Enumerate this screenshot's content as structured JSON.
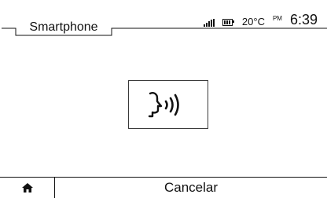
{
  "header": {
    "title": "Smartphone"
  },
  "status_bar": {
    "signal_icon": "signal-strength-icon",
    "battery_icon": "battery-icon",
    "temperature": "20°C",
    "am_pm": "PM",
    "time": "6:39"
  },
  "main": {
    "voice_button_icon": "voice-recognition-icon"
  },
  "bottom_bar": {
    "home_icon": "home-icon",
    "cancel_label": "Cancelar"
  }
}
